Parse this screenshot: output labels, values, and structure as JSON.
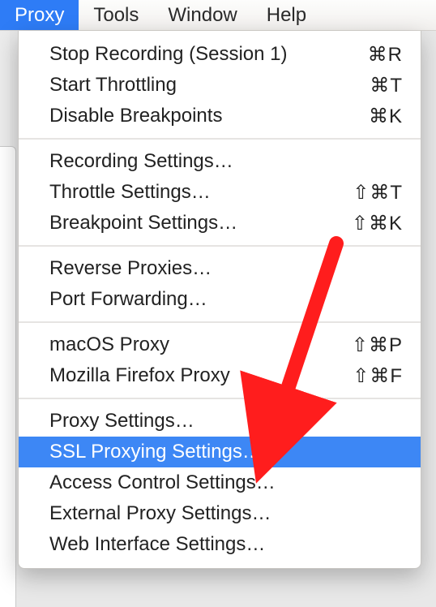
{
  "menubar": {
    "items": [
      {
        "label": "Proxy",
        "active": true
      },
      {
        "label": "Tools",
        "active": false
      },
      {
        "label": "Window",
        "active": false
      },
      {
        "label": "Help",
        "active": false
      }
    ]
  },
  "dropdown": {
    "groups": [
      [
        {
          "label": "Stop Recording (Session 1)",
          "shortcut": "⌘R"
        },
        {
          "label": "Start Throttling",
          "shortcut": "⌘T"
        },
        {
          "label": "Disable Breakpoints",
          "shortcut": "⌘K"
        }
      ],
      [
        {
          "label": "Recording Settings…",
          "shortcut": ""
        },
        {
          "label": "Throttle Settings…",
          "shortcut": "⇧⌘T"
        },
        {
          "label": "Breakpoint Settings…",
          "shortcut": "⇧⌘K"
        }
      ],
      [
        {
          "label": "Reverse Proxies…",
          "shortcut": ""
        },
        {
          "label": "Port Forwarding…",
          "shortcut": ""
        }
      ],
      [
        {
          "label": "macOS Proxy",
          "shortcut": "⇧⌘P"
        },
        {
          "label": "Mozilla Firefox Proxy",
          "shortcut": "⇧⌘F"
        }
      ],
      [
        {
          "label": "Proxy Settings…",
          "shortcut": ""
        },
        {
          "label": "SSL Proxying Settings…",
          "shortcut": "",
          "selected": true
        },
        {
          "label": "Access Control Settings…",
          "shortcut": ""
        },
        {
          "label": "External Proxy Settings…",
          "shortcut": ""
        },
        {
          "label": "Web Interface Settings…",
          "shortcut": ""
        }
      ]
    ]
  },
  "annotation": {
    "arrow_color": "#ff1d1d"
  }
}
